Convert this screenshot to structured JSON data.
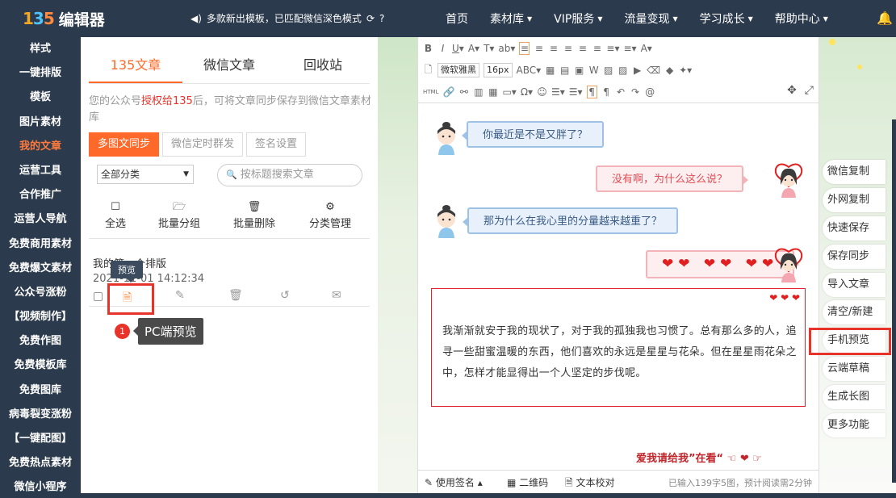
{
  "header": {
    "logo_mark": "135",
    "logo_text": "编辑器",
    "notice": "多款新出模板，已匹配微信深色模式",
    "nav": [
      {
        "label": "首页"
      },
      {
        "label": "素材库"
      },
      {
        "label": "VIP服务"
      },
      {
        "label": "流量变现"
      },
      {
        "label": "学习成长"
      },
      {
        "label": "帮助中心"
      }
    ]
  },
  "sidebar": {
    "items": [
      "样式",
      "一键排版",
      "模板",
      "图片素材",
      "我的文章",
      "运营工具",
      "合作推广",
      "运营人导航",
      "免费商用素材",
      "免费爆文素材",
      "公众号涨粉",
      "【视频制作】",
      "免费作图",
      "免费模板库",
      "免费图库",
      "病毒裂变涨粉",
      "【一键配图】",
      "免费热点素材",
      "微信小程序"
    ],
    "active_index": 4
  },
  "article_panel": {
    "tabs": [
      "135文章",
      "微信文章",
      "回收站"
    ],
    "tip_prefix": "您的公众号",
    "tip_highlight": "授权给135",
    "tip_suffix": "后，可将文章同步保存到微信文章素材库",
    "sync_buttons": [
      "多图文同步",
      "微信定时群发",
      "签名设置"
    ],
    "category_select": "全部分类",
    "search_placeholder": "按标题搜索文章",
    "actions": [
      {
        "label": "全选",
        "icon": "checkbox-icon"
      },
      {
        "label": "批量分组",
        "icon": "folder-open-icon"
      },
      {
        "label": "批量删除",
        "icon": "trash-icon"
      },
      {
        "label": "分类管理",
        "icon": "gear-icon"
      }
    ],
    "article": {
      "title": "我的第一个排版",
      "time": "2021-11-01 14:12:34"
    },
    "tooltip_preview": "预览",
    "step_number": "1",
    "step_label": "PC端预览"
  },
  "editor": {
    "font_name": "微软雅黑",
    "font_size": "16px",
    "toolbar_row1": [
      "B",
      "I",
      "U",
      "A",
      "T",
      "ab",
      "≡",
      "≡",
      "≡",
      "≡",
      "≡",
      "≡",
      "≡",
      "≡",
      "A"
    ],
    "toolbar_row3_label": "HTML",
    "chat": [
      {
        "side": "left",
        "text": "你最近是不是又胖了？"
      },
      {
        "side": "right",
        "text": "没有啊，为什么这么说？"
      },
      {
        "side": "left",
        "text": "那为什么在我心里的分量越来越重了？"
      },
      {
        "side": "right",
        "text": "❤❤ ❤❤ ❤❤"
      }
    ],
    "paragraph": "我渐渐就安于我的现状了，对于我的孤独我也习惯了。总有那么多的人，追寻一些甜蜜温暖的东西，他们喜欢的永远是星星与花朵。但在星星雨花朵之中，怎样才能显得出一个人坚定的步伐呢。",
    "footer_text": "爱我请给我”在看“",
    "status": {
      "signature": "使用签名",
      "qrcode": "二维码",
      "proofread": "文本校对",
      "count": "已输入139字5图，预计阅读需2分钟"
    }
  },
  "right_menu": {
    "items": [
      "微信复制",
      "外网复制",
      "快速保存",
      "保存同步",
      "导入文章",
      "清空/新建",
      "手机预览",
      "云端草稿",
      "生成长图",
      "更多功能"
    ],
    "highlight_index": 6
  },
  "colors": {
    "dark_nav": "#2b3a4d",
    "accent_orange": "#ff6a2a",
    "highlight_red": "#e8332a",
    "bubble_blue": "#e8f1fb",
    "bubble_pink": "#fdeff0"
  }
}
